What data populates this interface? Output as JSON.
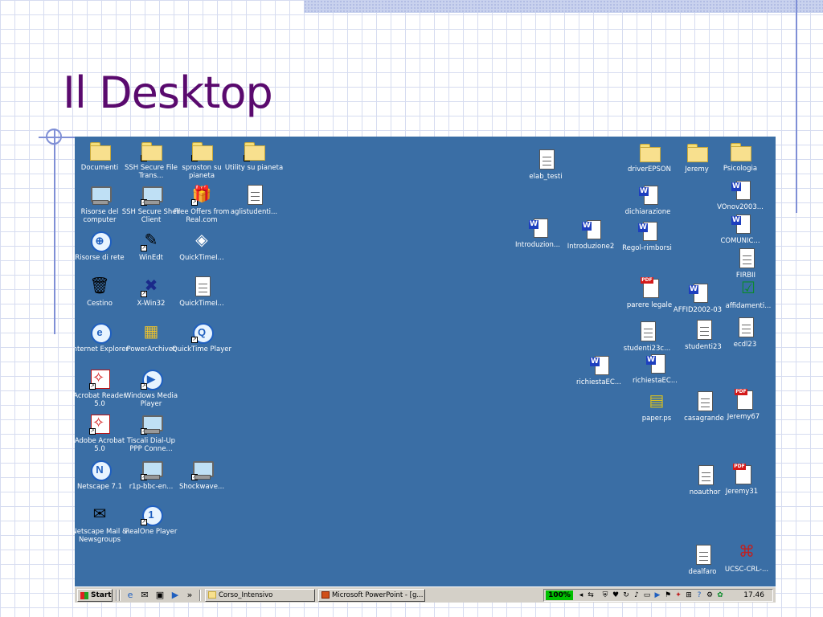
{
  "slide": {
    "title": "Il Desktop"
  },
  "desktop_icons": {
    "documenti": "Documenti",
    "ssh_file": "SSH Secure File Trans...",
    "sproston": "sproston su pianeta",
    "utility": "Utility su pianeta",
    "risorse_computer": "Risorse del computer",
    "ssh_shell": "SSH Secure Shell Client",
    "free_offers": "Free Offers from Real.com",
    "aglistudenti": "aglistudenti...",
    "risorse_rete": "Risorse di rete",
    "winedt": "WinEdt",
    "quicktime1": "QuickTimeI...",
    "cestino": "Cestino",
    "xwin32": "X-Win32",
    "quicktime2": "QuickTimeI...",
    "internet_explorer": "Internet Explorer",
    "powerarchiver": "PowerArchiver",
    "quicktime_player": "QuickTime Player",
    "acrobat_reader": "Acrobat Reader 5.0",
    "windows_media": "Windows Media Player",
    "adobe_acrobat": "Adobe Acrobat 5.0",
    "tiscali": "Tiscali Dial-Up PPP Conne...",
    "netscape": "Netscape 7.1",
    "r1p": "r1p-bbc-en...",
    "shockwave": "Shockwave...",
    "netscape_mail": "Netscape Mail & Newsgroups",
    "realone": "RealOne Player",
    "elab_testi": "elab_testi",
    "introduzion": "Introduzion...",
    "introduzione2": "Introduzione2",
    "regol_rimborsi": "Regol-rimborsi",
    "driverepson": "driverEPSON",
    "jeremy": "Jeremy",
    "psicologia": "Psicologia",
    "dichiarazione": "dichiarazione",
    "vonov2003": "VOnov2003...",
    "comunic": "COMUNIC...",
    "firbii": "FIRBII",
    "parere_legale": "parere legale",
    "affid2002": "AFFID2002-03",
    "affidamenti": "affidamenti...",
    "studenti23c": "studenti23c...",
    "studenti23": "studenti23",
    "ecdl23": "ecdl23",
    "richiestaec1": "richiestaEC...",
    "richiestaec2": "richiestaEC...",
    "paper_ps": "paper.ps",
    "casagrande": "casagrande",
    "jeremy67": "Jeremy67",
    "noauthor": "noauthor",
    "jeremy31": "Jeremy31",
    "dealfaro": "dealfaro",
    "ucsc_crl": "UCSC-CRL-..."
  },
  "taskbar": {
    "start_label": "Start",
    "chevron": "»",
    "task1": "Corso_Intensivo",
    "task2": "Microsoft PowerPoint - [g...",
    "zoom": "100%",
    "clock": "17.46"
  }
}
